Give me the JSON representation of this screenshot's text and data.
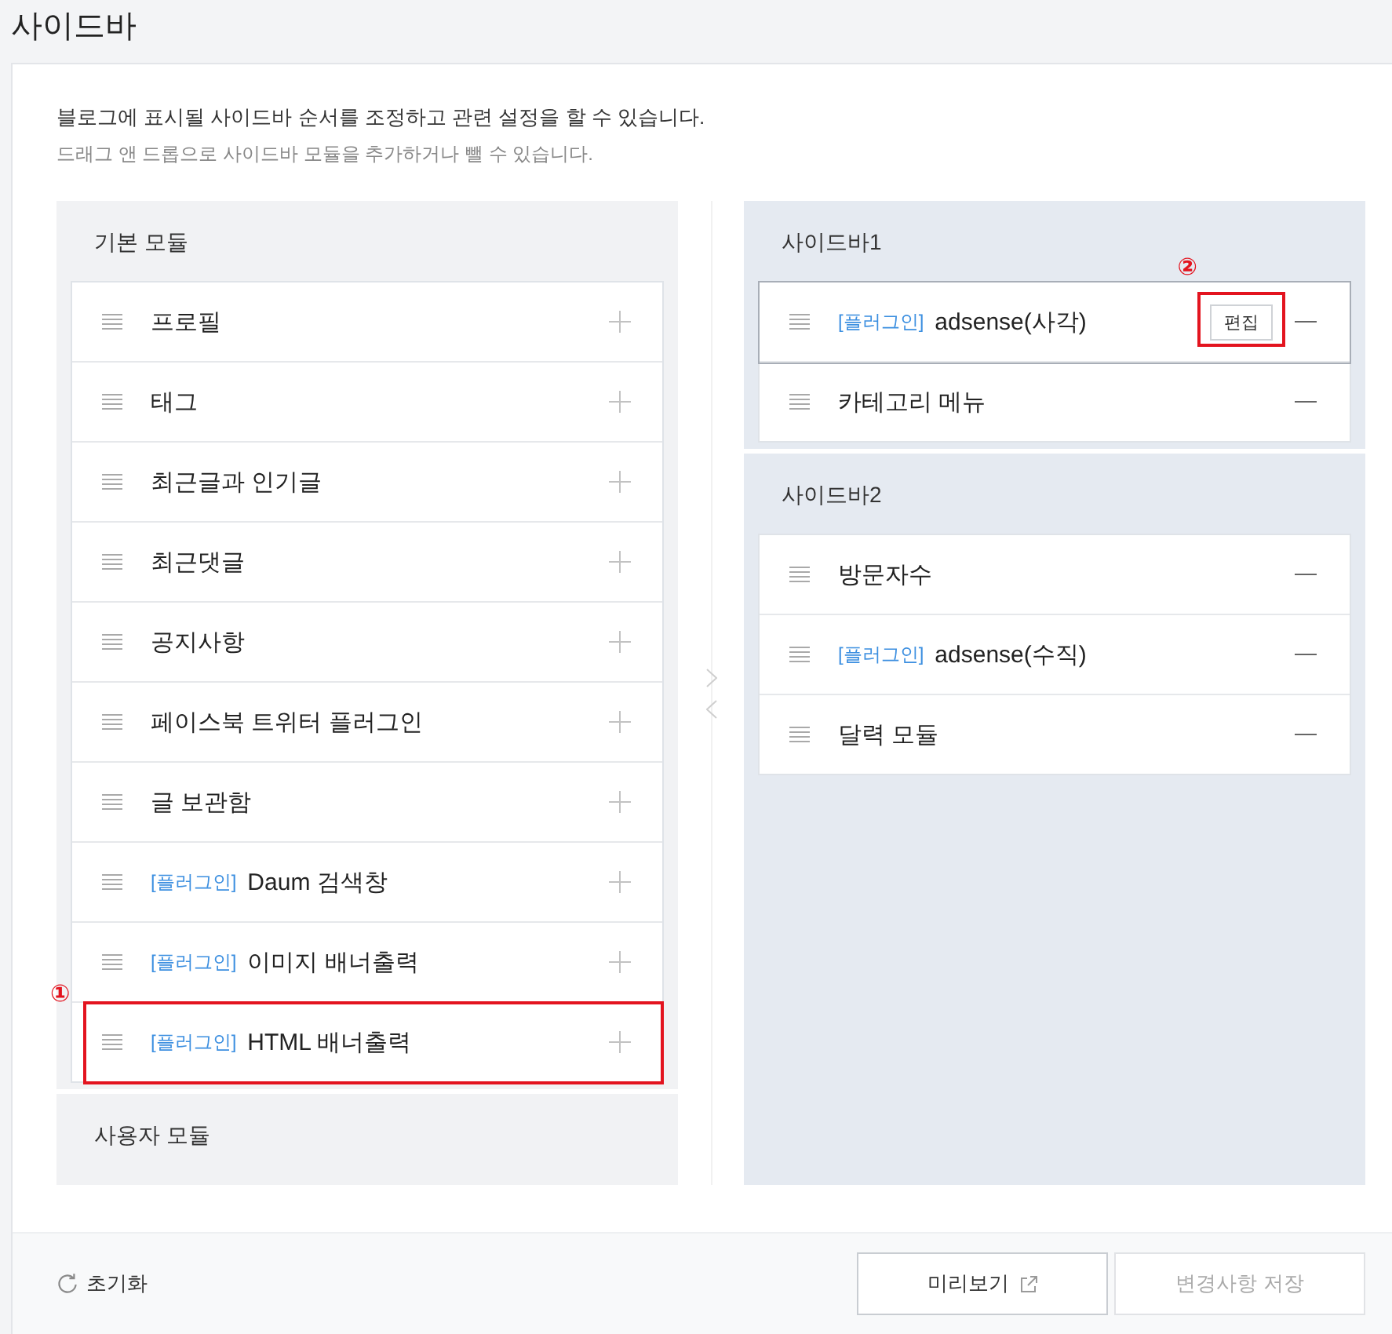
{
  "page_title": "사이드바",
  "intro": {
    "text": "블로그에 표시될 사이드바 순서를 조정하고 관련 설정을 할 수 있습니다.",
    "hint": "드래그 앤 드롭으로 사이드바 모듈을 추가하거나 뺄 수 있습니다."
  },
  "module_groups": [
    {
      "title": "기본 모듈",
      "items": [
        {
          "name": "프로필"
        },
        {
          "name": "태그"
        },
        {
          "name": "최근글과 인기글"
        },
        {
          "name": "최근댓글"
        },
        {
          "name": "공지사항"
        },
        {
          "name": "페이스북 트위터 플러그인"
        },
        {
          "name": "글 보관함"
        },
        {
          "tag": "[플러그인]",
          "name": "Daum 검색창"
        },
        {
          "tag": "[플러그인]",
          "name": "이미지 배너출력"
        },
        {
          "tag": "[플러그인]",
          "name": "HTML 배너출력",
          "callout": "①"
        }
      ]
    },
    {
      "title": "사용자 모듈"
    }
  ],
  "sidebars": [
    {
      "title": "사이드바1",
      "items": [
        {
          "tag": "[플러그인]",
          "name": "adsense(사각)",
          "selected": true,
          "edit_label": "편집",
          "callout": "②"
        },
        {
          "name": "카테고리 메뉴",
          "selected": false
        }
      ]
    },
    {
      "title": "사이드바2",
      "items": [
        {
          "name": "방문자수",
          "selected": false
        },
        {
          "tag": "[플러그인]",
          "name": "adsense(수직)",
          "selected": false
        },
        {
          "name": "달력 모듈",
          "selected": false
        }
      ]
    }
  ],
  "footer": {
    "reset_label": "초기화",
    "buttons": [
      {
        "label": "미리보기",
        "kind": "preview",
        "disabled": false
      },
      {
        "label": "변경사항 저장",
        "kind": "save",
        "disabled": true
      }
    ]
  }
}
